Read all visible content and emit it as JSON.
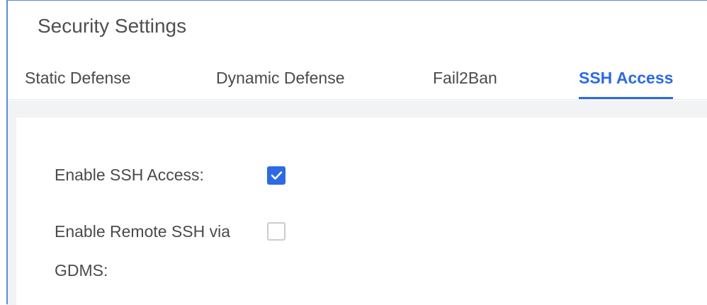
{
  "page": {
    "title": "Security Settings"
  },
  "tabs": [
    {
      "label": "Static Defense",
      "active": false
    },
    {
      "label": "Dynamic Defense",
      "active": false
    },
    {
      "label": "Fail2Ban",
      "active": false
    },
    {
      "label": "SSH Access",
      "active": true
    }
  ],
  "form": {
    "enable_ssh": {
      "label": "Enable SSH Access:",
      "checked": true
    },
    "enable_remote_ssh": {
      "label_line1": "Enable Remote SSH via",
      "label_line2": "GDMS:",
      "checked": false
    }
  },
  "colors": {
    "accent": "#2d6ae3",
    "frame_border": "#5b8bd6",
    "content_bg": "#f2f3f5"
  },
  "icons": {
    "checkmark": "checkmark-icon"
  }
}
